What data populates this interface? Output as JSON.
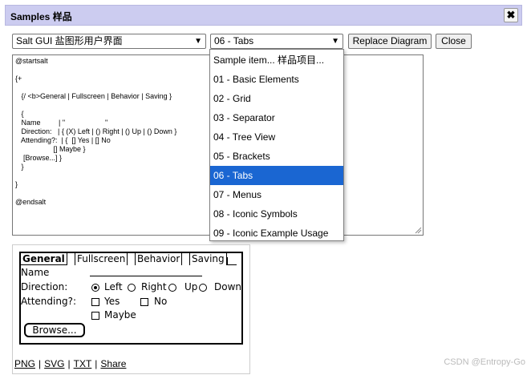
{
  "dialog": {
    "title": "Samples 样品",
    "close_glyph": "✖"
  },
  "toolbar": {
    "category_value": "Salt GUI 盐图形用户界面",
    "sample_value": "06 - Tabs",
    "replace_label": "Replace Diagram",
    "close_label": "Close"
  },
  "editor": {
    "code": "@startsalt\n\n{+\n\n   {/ <b>General | Fullscreen | Behavior | Saving }\n\n   {\n   Name         | \"                    \"\n   Direction:   | { (X) Left | () Right | () Up | () Down }\n   Attending?:  | {  [] Yes | [] No\n                   [] Maybe }\n    [Browse...] }\n   }\n\n}\n\n@endsalt"
  },
  "dropdown": {
    "options": [
      "Sample item... 样品项目...",
      "01 - Basic Elements",
      "02 - Grid",
      "03 - Separator",
      "04 - Tree View",
      "05 - Brackets",
      "06 - Tabs",
      "07 - Menus",
      "08 - Iconic Symbols",
      "09 - Iconic Example Usage"
    ],
    "selected_index": 6,
    "highlight_color": "#1a66d2"
  },
  "preview": {
    "tabs": [
      "General",
      "Fullscreen",
      "Behavior",
      "Saving"
    ],
    "name_label": "Name",
    "direction_label": "Direction:",
    "direction_options": [
      "Left",
      "Right",
      "Up",
      "Down"
    ],
    "attending_label": "Attending?:",
    "attending_options": [
      "Yes",
      "No",
      "Maybe"
    ],
    "browse_label": "Browse..."
  },
  "links": [
    "PNG",
    "SVG",
    "TXT",
    "Share"
  ],
  "watermark": "CSDN @Entropy-Go"
}
